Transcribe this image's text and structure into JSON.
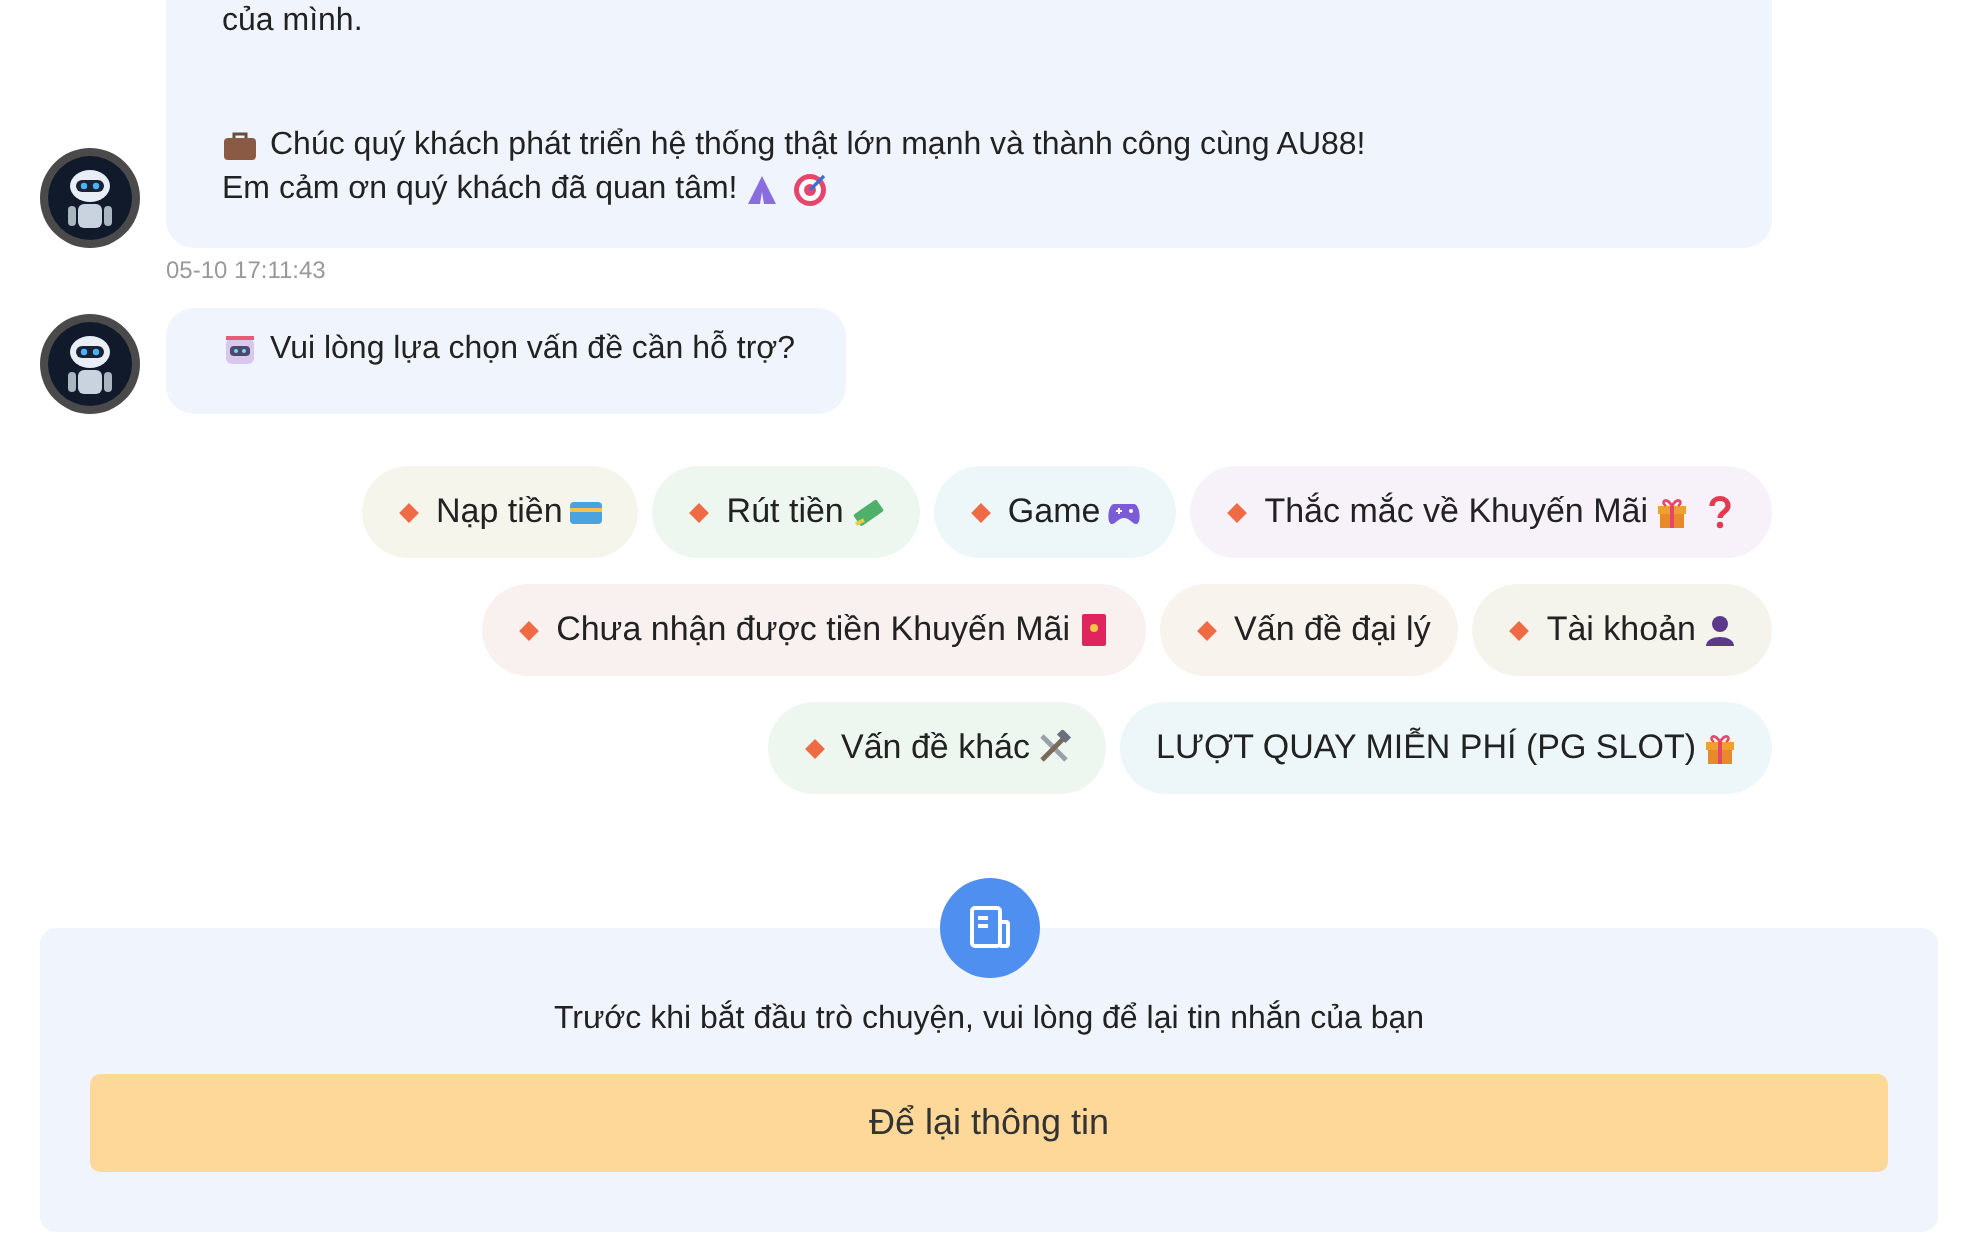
{
  "messages": [
    {
      "lines": [
        "của mình.",
        "Chúc quý khách phát triển hệ thống thật lớn mạnh và thành công cùng AU88!",
        "Em cảm ơn quý khách đã quan tâm!"
      ],
      "timestamp": "05-10 17:11:43"
    },
    {
      "lines": [
        "Vui lòng lựa chọn vấn đề cần hỗ trợ?"
      ]
    }
  ],
  "options": [
    [
      {
        "label": "Nạp tiền",
        "bullet": true,
        "color": "#f5f5ec"
      },
      {
        "label": "Rút tiền",
        "bullet": true,
        "color": "#eef6f0"
      },
      {
        "label": "Game",
        "bullet": true,
        "color": "#edf7f9"
      },
      {
        "label": "Thắc mắc về Khuyến Mãi",
        "bullet": true,
        "color": "#f7f1f9"
      }
    ],
    [
      {
        "label": "Chưa nhận được tiền Khuyến Mãi",
        "bullet": true,
        "color": "#f9f0f0"
      },
      {
        "label": "Vấn đề đại lý",
        "bullet": true,
        "color": "#f9f3ee"
      },
      {
        "label": "Tài khoản",
        "bullet": true,
        "color": "#f5f4ec"
      }
    ],
    [
      {
        "label": "Vấn đề khác",
        "bullet": true,
        "color": "#eef6f0"
      },
      {
        "label": "LƯỢT QUAY MIỄN PHÍ (PG SLOT)",
        "bullet": false,
        "color": "#edf7f9"
      }
    ]
  ],
  "notice": {
    "text": "Trước khi bắt đầu trò chuyện, vui lòng để lại tin nhắn của bạn",
    "button": "Để lại thông tin"
  }
}
